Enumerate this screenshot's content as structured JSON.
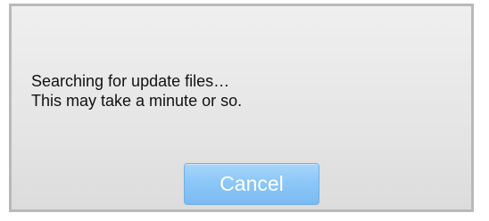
{
  "dialog": {
    "message_line_1": "Searching for update files…",
    "message_line_2": "This may take a minute or so.",
    "cancel_label": "Cancel"
  },
  "colors": {
    "button_fill": "#8cc7f8",
    "button_text": "#ffffff",
    "dialog_border": "#b9b9b9"
  }
}
